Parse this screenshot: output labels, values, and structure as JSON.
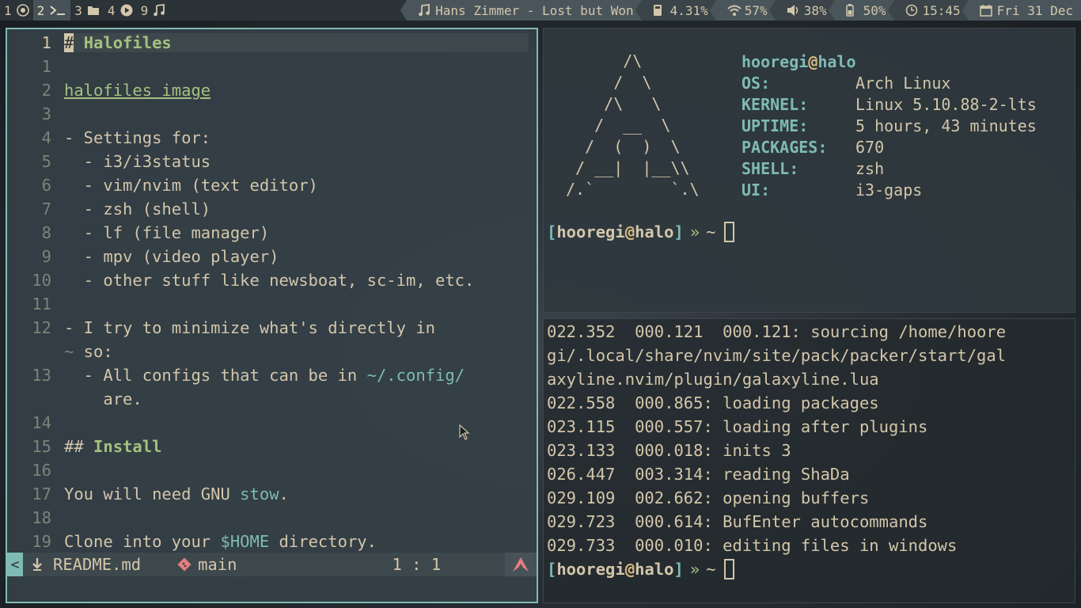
{
  "bar": {
    "workspaces": [
      {
        "num": "1",
        "icon": "chrome-icon",
        "active": false
      },
      {
        "num": "2",
        "icon": "terminal-icon",
        "active": true
      },
      {
        "num": "3",
        "icon": "folder-icon",
        "active": false
      },
      {
        "num": "4",
        "icon": "play-icon",
        "active": false
      },
      {
        "num": "9",
        "icon": "music-icon",
        "active": false
      }
    ],
    "now_playing": "Hans Zimmer - Lost but Won",
    "disk": "4.31%",
    "wifi": "57%",
    "volume": "38%",
    "battery": "50%",
    "time": "15:45",
    "date": "Fri 31 Dec"
  },
  "editor": {
    "lines": [
      {
        "num": "1",
        "text": "# Halofiles"
      },
      {
        "num": "1",
        "text": ""
      },
      {
        "num": "2",
        "text": "halofiles image"
      },
      {
        "num": "3",
        "text": ""
      },
      {
        "num": "4",
        "text": "- Settings for:"
      },
      {
        "num": "5",
        "text": "  - i3/i3status"
      },
      {
        "num": "6",
        "text": "  - vim/nvim (text editor)"
      },
      {
        "num": "7",
        "text": "  - zsh (shell)"
      },
      {
        "num": "8",
        "text": "  - lf (file manager)"
      },
      {
        "num": "9",
        "text": "  - mpv (video player)"
      },
      {
        "num": "10",
        "text": "  - other stuff like newsboat, sc-im, etc."
      },
      {
        "num": "11",
        "text": ""
      },
      {
        "num": "12",
        "text": "- I try to minimize what's directly in"
      },
      {
        "num": "~",
        "text": "  so:"
      },
      {
        "num": "13",
        "text": "  - All configs that can be in ~/.config/"
      },
      {
        "num": "",
        "text": "    are."
      },
      {
        "num": "14",
        "text": ""
      },
      {
        "num": "15",
        "text": "## Install"
      },
      {
        "num": "16",
        "text": ""
      },
      {
        "num": "17",
        "text": "You will need GNU stow."
      },
      {
        "num": "18",
        "text": ""
      },
      {
        "num": "19",
        "text": "Clone into your $HOME directory."
      }
    ],
    "heading1_hash": "#",
    "heading1_text": "Halofiles",
    "link_text": "halofiles image",
    "config_path": "~/.config/",
    "heading2_hash": "##",
    "heading2_text": "Install",
    "stow_pre": "You will need GNU ",
    "stow_word": "stow",
    "stow_post": ".",
    "clone_pre": "Clone into your ",
    "clone_var": "$HOME",
    "clone_post": " directory.",
    "line13_pre": "  - All configs that can be in "
  },
  "statusline": {
    "mode_cap": "<",
    "filename": "README.md",
    "branch": "main",
    "position": "1 : 1"
  },
  "fetch": {
    "ascii": "      /\\\n     /  \\\n    /\\   \\\n   /  __  \\\n  /  (  )  \\\n / __|  |__\\\\\n/.`        `.\\",
    "user": "hooregi",
    "at": "@",
    "host": "halo",
    "rows": [
      {
        "key": "OS:",
        "value": "Arch Linux"
      },
      {
        "key": "KERNEL:",
        "value": "Linux 5.10.88-2-lts"
      },
      {
        "key": "UPTIME:",
        "value": "5 hours, 43 minutes"
      },
      {
        "key": "PACKAGES:",
        "value": "670"
      },
      {
        "key": "SHELL:",
        "value": "zsh"
      },
      {
        "key": "UI:",
        "value": "i3-gaps"
      }
    ]
  },
  "prompt": {
    "open": "[",
    "user": "hooregi",
    "at": "@",
    "host": "halo",
    "close": "]",
    "arrow": "»",
    "dir": "~"
  },
  "term": {
    "lines": [
      "022.352  000.121  000.121: sourcing /home/hoore",
      "gi/.local/share/nvim/site/pack/packer/start/gal",
      "axyline.nvim/plugin/galaxyline.lua",
      "022.558  000.865: loading packages",
      "023.115  000.557: loading after plugins",
      "023.133  000.018: inits 3",
      "026.447  003.314: reading ShaDa",
      "029.109  002.662: opening buffers",
      "029.723  000.614: BufEnter autocommands",
      "029.733  000.010: editing files in windows"
    ]
  },
  "colors": {
    "accent": "#7fbbb3",
    "green": "#a7c080",
    "yellow": "#dbbc7f",
    "red": "#e67e80",
    "fg": "#d3c6aa",
    "bg": "#2b3339"
  }
}
